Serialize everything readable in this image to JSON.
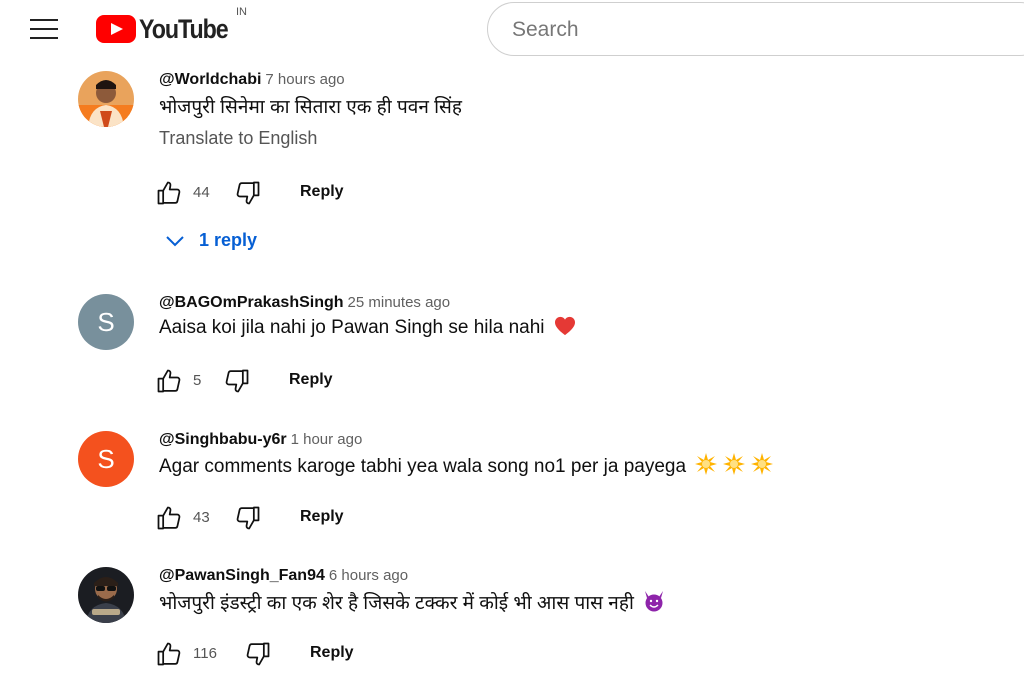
{
  "header": {
    "logo_text": "YouTube",
    "country_code": "IN",
    "search_placeholder": "Search"
  },
  "comments": [
    {
      "author": "@Worldchabi",
      "time": "7 hours ago",
      "text": "भोजपुरी सिनेमा का सितारा एक ही पवन सिंह",
      "translate_label": "Translate to English",
      "likes": "44",
      "reply_label": "Reply",
      "replies_label": "1 reply",
      "avatar": "photo"
    },
    {
      "author": "@BAGOmPrakashSingh",
      "time": "25 minutes ago",
      "text": "Aaisa koi jila nahi jo Pawan Singh se hila nahi",
      "emoji": "red-heart-icon",
      "likes": "5",
      "reply_label": "Reply",
      "avatar_letter": "S",
      "avatar_color": "#78909c"
    },
    {
      "author": "@Singhbabu-y6r",
      "time": "1 hour ago",
      "text": "Agar comments karoge tabhi yea wala song no1 per ja payega",
      "emoji": "collision-icon x3",
      "likes": "43",
      "reply_label": "Reply",
      "avatar_letter": "S",
      "avatar_color": "#f4511e"
    },
    {
      "author": "@PawanSingh_Fan94",
      "time": "6 hours ago",
      "text": "भोजपुरी इंडस्ट्री का एक शेर है जिसके टक्कर में कोई भी आस पास नही",
      "emoji": "smiling-devil-icon",
      "likes": "116",
      "reply_label": "Reply",
      "avatar": "photo"
    }
  ],
  "colors": {
    "brand_red": "#ff0000",
    "link_blue": "#065fd4"
  }
}
